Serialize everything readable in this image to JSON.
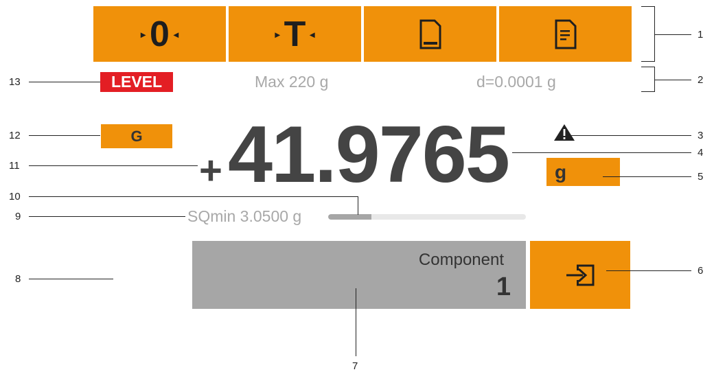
{
  "toolbar": {
    "zero_label": "0",
    "tare_label": "T",
    "zero_icon": "zero-arrows-icon",
    "tare_icon": "tare-arrows-icon",
    "print_icon": "print-page-icon",
    "report_icon": "document-report-icon",
    "button_color": "#f0910a"
  },
  "info": {
    "level_label": "LEVEL",
    "level_color": "#e31e24",
    "max_capacity": "Max 220 g",
    "readability": "d=0.0001 g"
  },
  "weight": {
    "mode_label": "G",
    "sign": "+",
    "value": "41.9765",
    "unit": "g",
    "warning_icon": "warning-triangle-icon",
    "sqmin_label": "SQmin 3.0500 g",
    "sqmin_progress": 0.22
  },
  "component": {
    "label": "Component",
    "number": "1",
    "enter_icon": "enter-arrow-icon"
  },
  "callouts": {
    "c1": "1",
    "c2": "2",
    "c3": "3",
    "c4": "4",
    "c5": "5",
    "c6": "6",
    "c7": "7",
    "c8": "8",
    "c9": "9",
    "c10": "10",
    "c11": "11",
    "c12": "12",
    "c13": "13"
  }
}
